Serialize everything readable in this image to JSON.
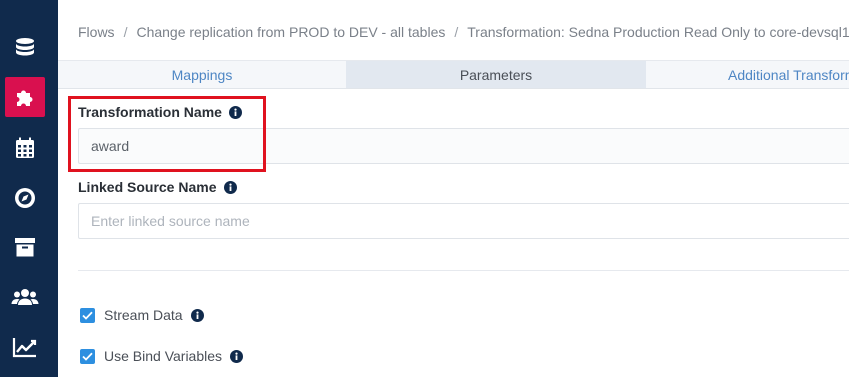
{
  "sidebar": {
    "items": [
      {
        "icon": "database-icon",
        "active": false
      },
      {
        "icon": "puzzle-icon",
        "active": true
      },
      {
        "icon": "calendar-icon",
        "active": false
      },
      {
        "icon": "compass-icon",
        "active": false
      },
      {
        "icon": "archive-icon",
        "active": false
      },
      {
        "icon": "users-icon",
        "active": false
      },
      {
        "icon": "chart-line-icon",
        "active": false
      }
    ],
    "colors": {
      "background": "#102a4c",
      "active": "#d9104f"
    }
  },
  "breadcrumb": {
    "items": [
      "Flows",
      "Change replication from PROD to DEV - all tables",
      "Transformation: Sedna Production Read Only to core-devsql1"
    ],
    "separator": "/"
  },
  "tabs": [
    {
      "label": "Mappings",
      "active": false
    },
    {
      "label": "Parameters",
      "active": true
    },
    {
      "label": "Additional Transform",
      "active": false
    }
  ],
  "form": {
    "transformation_name": {
      "label": "Transformation Name",
      "value": "award"
    },
    "linked_source_name": {
      "label": "Linked Source Name",
      "value": "",
      "placeholder": "Enter linked source name"
    },
    "stream_data": {
      "label": "Stream Data",
      "checked": true
    },
    "use_bind_variables": {
      "label": "Use Bind Variables",
      "checked": true
    }
  },
  "highlight_color": "#e0121f"
}
